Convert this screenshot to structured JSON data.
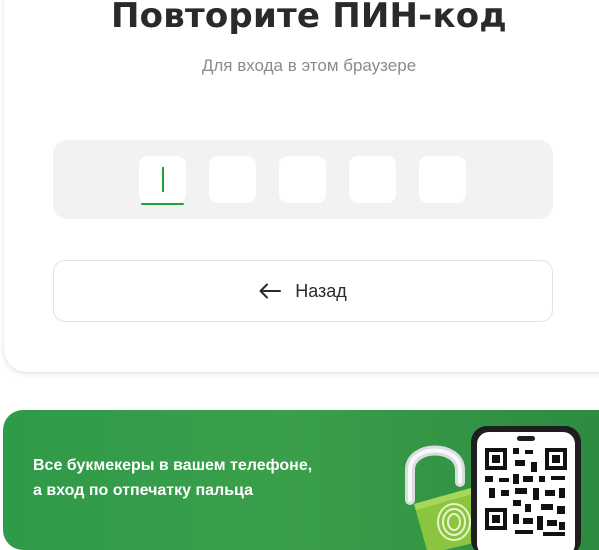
{
  "pin": {
    "title": "Повторите ПИН-код",
    "subtitle": "Для входа в этом браузере",
    "digits": [
      "",
      "",
      "",
      "",
      ""
    ],
    "active_index": 0
  },
  "back_button": {
    "label": "Назад",
    "icon": "arrow-left-icon"
  },
  "promo_banner": {
    "text_line1": "Все букмекеры в вашем телефоне,",
    "text_line2": "а вход по отпечатку пальца",
    "images": [
      "padlock-fingerprint-icon",
      "phone-qr-code-icon"
    ]
  },
  "colors": {
    "accent": "#21a038",
    "banner_bg": "#2f9a49",
    "title": "#2a2a2a",
    "subtitle": "#8b8b8b",
    "pin_panel_bg": "#f2f2f3"
  }
}
